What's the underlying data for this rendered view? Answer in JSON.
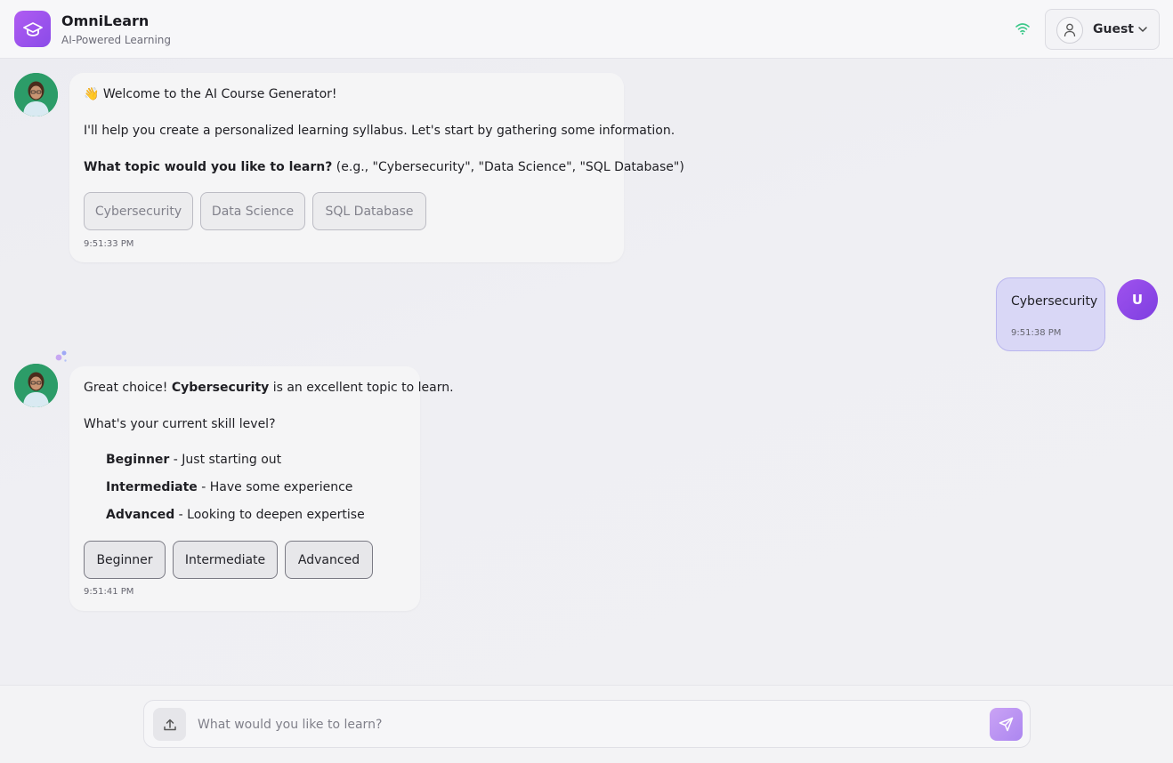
{
  "header": {
    "app_title": "OmniLearn",
    "app_subtitle": "AI-Powered Learning",
    "user_name": "Guest",
    "logo_icon": "graduation-cap-icon",
    "connection_icon": "wifi-icon",
    "user_icon": "user-icon",
    "menu_icon": "chevron-down-icon"
  },
  "messages": [
    {
      "role": "assistant",
      "greeting_emoji": "👋",
      "greeting": "Welcome to the AI Course Generator!",
      "intro": "I'll help you create a personalized learning syllabus. Let's start by gathering some information.",
      "question_bold": "What topic would you like to learn?",
      "question_rest": " (e.g., \"Cybersecurity\", \"Data Science\", \"SQL Database\")",
      "options": [
        "Cybersecurity",
        "Data Science",
        "SQL Database"
      ],
      "time": "9:51:33 PM"
    },
    {
      "role": "user",
      "text": "Cybersecurity",
      "time": "9:51:38 PM",
      "avatar_initial": "U"
    },
    {
      "role": "assistant",
      "lead": "Great choice! ",
      "topic": "Cybersecurity",
      "lead_rest": " is an excellent topic to learn.",
      "question": "What's your current skill level?",
      "levels": [
        {
          "name": "Beginner",
          "desc": " - Just starting out"
        },
        {
          "name": "Intermediate",
          "desc": " - Have some experience"
        },
        {
          "name": "Advanced",
          "desc": " - Looking to deepen expertise"
        }
      ],
      "options": [
        "Beginner",
        "Intermediate",
        "Advanced"
      ],
      "time": "9:51:41 PM"
    }
  ],
  "composer": {
    "placeholder": "What would you like to learn?",
    "upload_icon": "upload-icon",
    "send_icon": "send-icon"
  },
  "colors": {
    "accent": "#8a4be8",
    "user_bubble": "#d9d7f6",
    "online": "#3cc88a",
    "avatar_bg": "#2c9c68"
  }
}
